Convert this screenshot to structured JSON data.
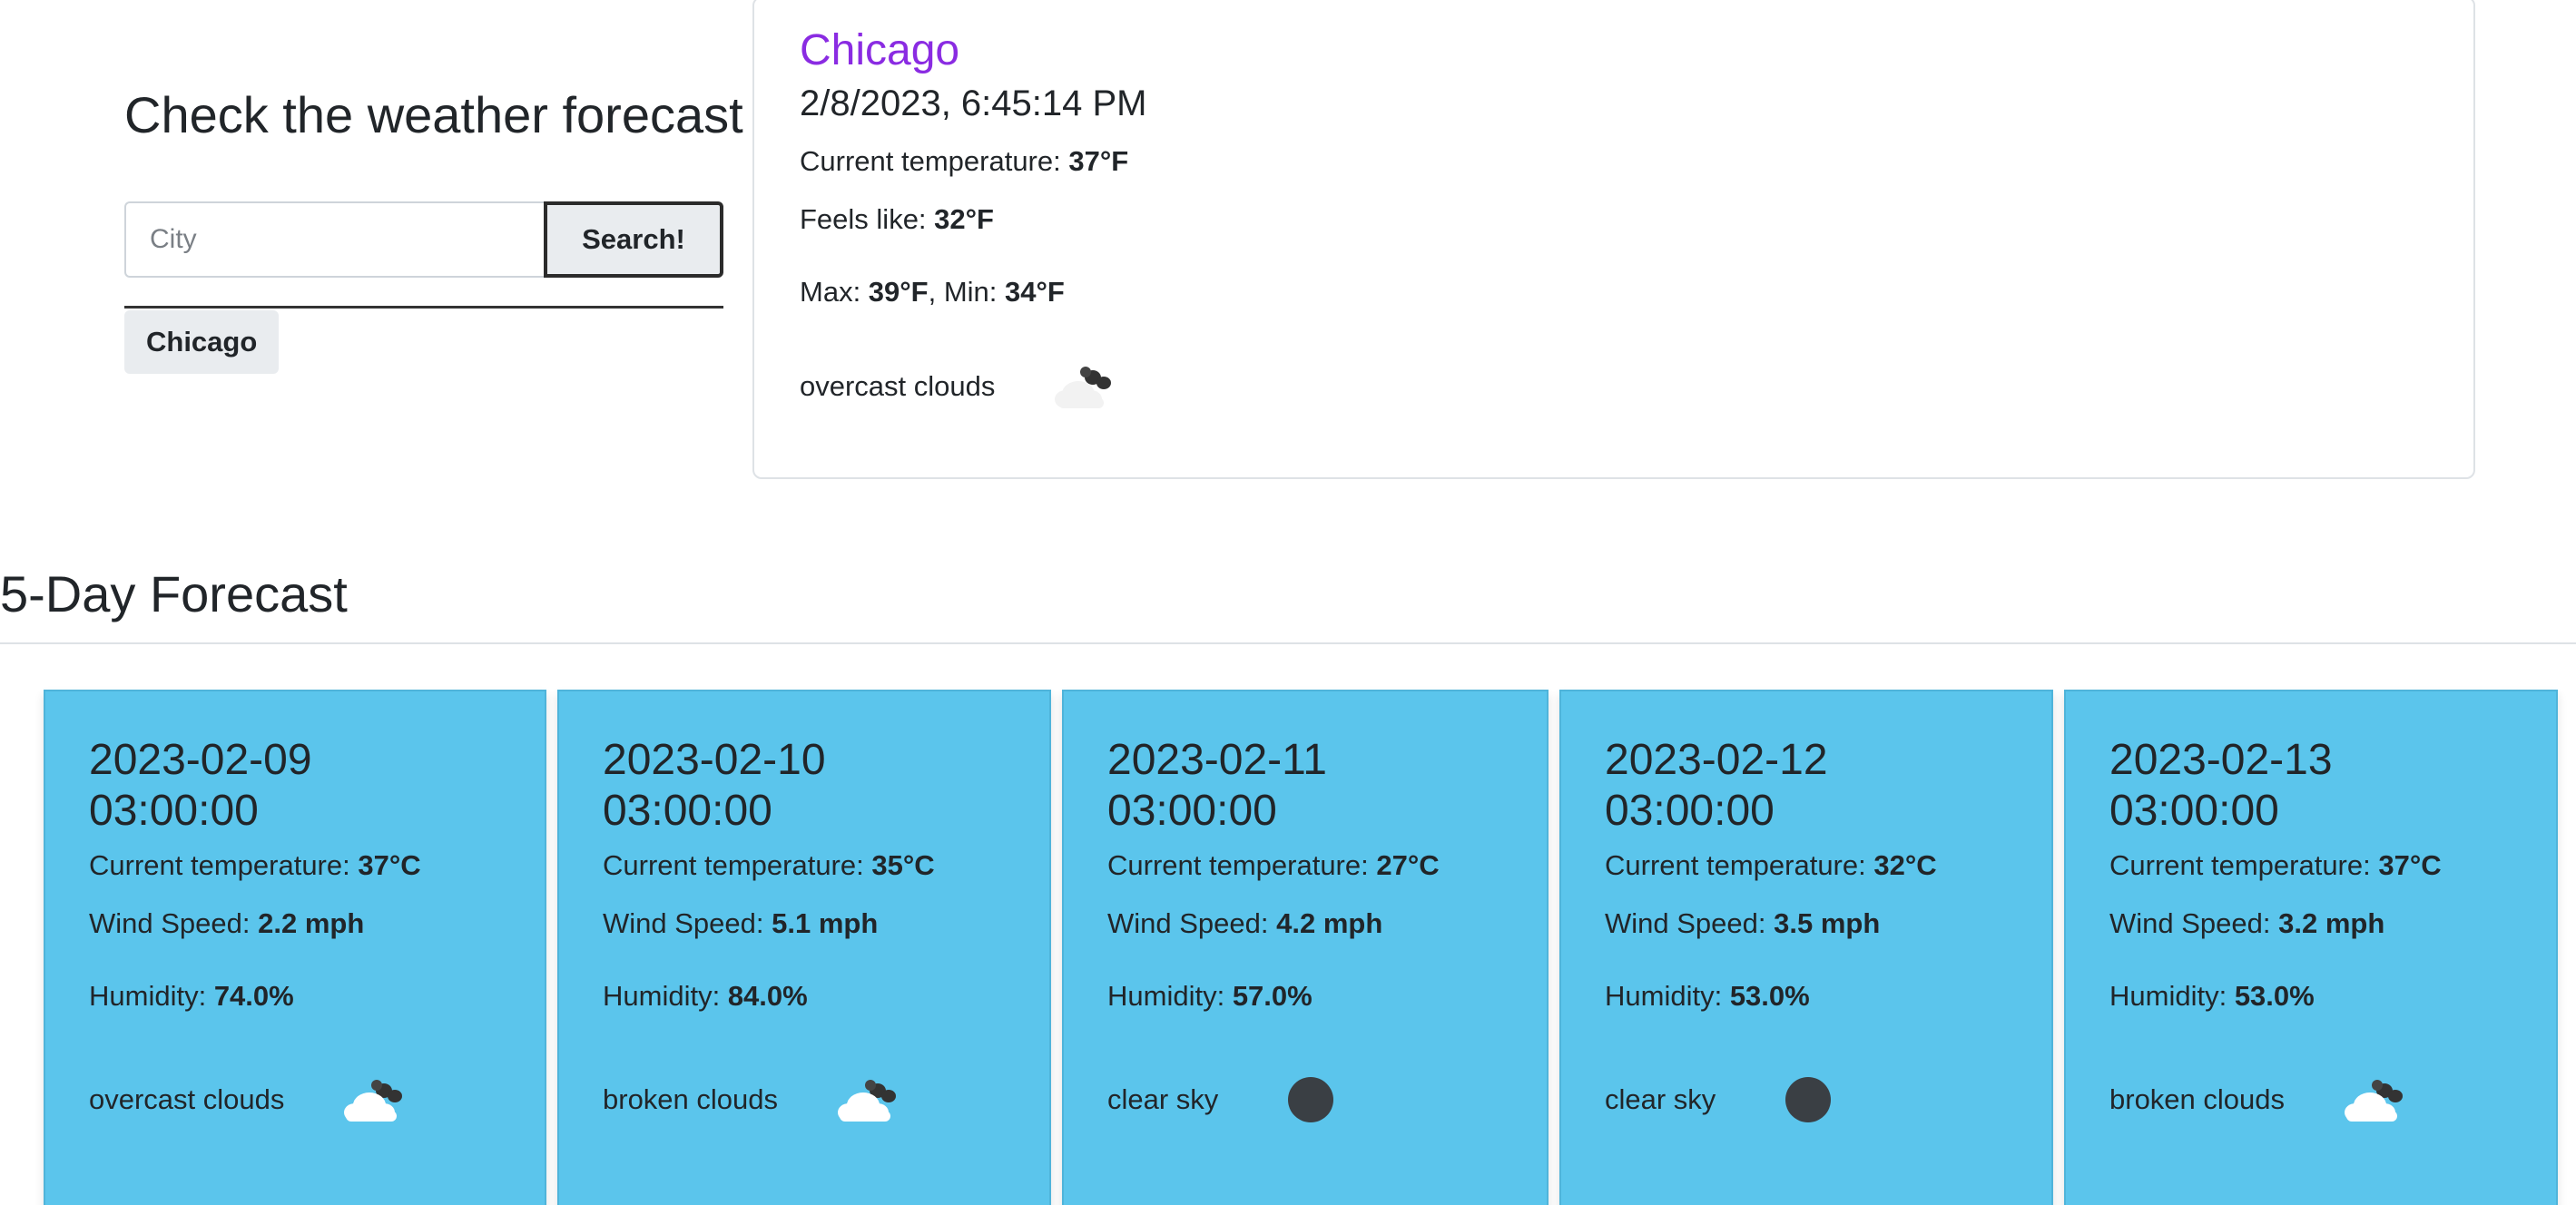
{
  "search": {
    "title": "Check the weather forecast",
    "placeholder": "City",
    "button_label": "Search!",
    "history": [
      "Chicago"
    ]
  },
  "current": {
    "city": "Chicago",
    "datetime": "2/8/2023, 6:45:14 PM",
    "temp_label": "Current temperature: ",
    "temp_value": "37°F",
    "feels_label": "Feels like: ",
    "feels_value": "32°F",
    "max_label": "Max: ",
    "max_value": "39°F",
    "min_sep": ", Min: ",
    "min_value": "34°F",
    "description": "overcast clouds",
    "icon": "overcast-clouds-icon"
  },
  "forecast": {
    "heading": "5-Day Forecast",
    "temp_label": "Current temperature: ",
    "wind_label": "Wind Speed: ",
    "humidity_label": "Humidity: ",
    "days": [
      {
        "date": "2023-02-09",
        "time": "03:00:00",
        "temp": "37°C",
        "wind": "2.2 mph",
        "humidity": "74.0%",
        "description": "overcast clouds",
        "icon": "overcast-clouds-icon"
      },
      {
        "date": "2023-02-10",
        "time": "03:00:00",
        "temp": "35°C",
        "wind": "5.1 mph",
        "humidity": "84.0%",
        "description": "broken clouds",
        "icon": "broken-clouds-icon"
      },
      {
        "date": "2023-02-11",
        "time": "03:00:00",
        "temp": "27°C",
        "wind": "4.2 mph",
        "humidity": "57.0%",
        "description": "clear sky",
        "icon": "clear-sky-night-icon"
      },
      {
        "date": "2023-02-12",
        "time": "03:00:00",
        "temp": "32°C",
        "wind": "3.5 mph",
        "humidity": "53.0%",
        "description": "clear sky",
        "icon": "clear-sky-night-icon"
      },
      {
        "date": "2023-02-13",
        "time": "03:00:00",
        "temp": "37°C",
        "wind": "3.2 mph",
        "humidity": "53.0%",
        "description": "broken clouds",
        "icon": "broken-clouds-icon"
      }
    ]
  },
  "colors": {
    "city_accent": "#8a2be2",
    "forecast_card_bg": "#5bc5ec"
  }
}
